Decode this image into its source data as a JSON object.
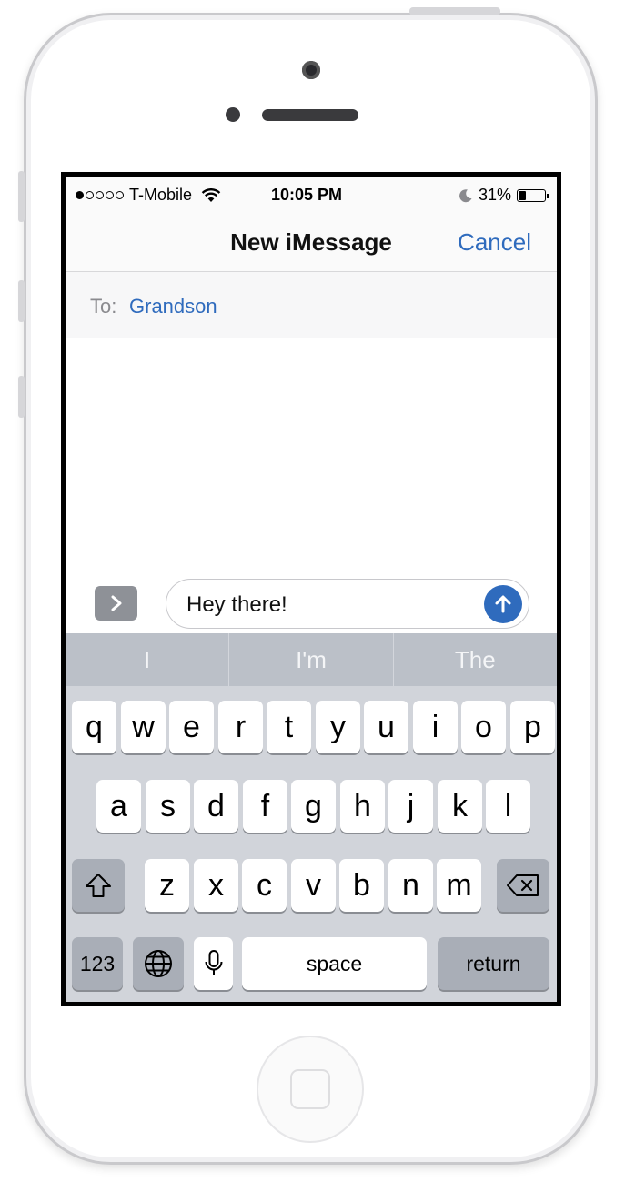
{
  "status_bar": {
    "signal_dots_filled": 1,
    "signal_dots_total": 5,
    "carrier": "T-Mobile",
    "time": "10:05 PM",
    "battery": "31%",
    "battery_level": 0.31
  },
  "nav": {
    "title": "New iMessage",
    "cancel_label": "Cancel"
  },
  "recipient": {
    "label": "To:",
    "name": "Grandson"
  },
  "compose": {
    "message_text": "Hey there!"
  },
  "suggestions": [
    "I",
    "I'm",
    "The"
  ],
  "keyboard": {
    "row1": [
      "q",
      "w",
      "e",
      "r",
      "t",
      "y",
      "u",
      "i",
      "o",
      "p"
    ],
    "row2": [
      "a",
      "s",
      "d",
      "f",
      "g",
      "h",
      "j",
      "k",
      "l"
    ],
    "row3": [
      "z",
      "x",
      "c",
      "v",
      "b",
      "n",
      "m"
    ],
    "numbers_label": "123",
    "space_label": "space",
    "return_label": "return"
  },
  "colors": {
    "accent": "#2f6bbd",
    "keyboard_bg": "#d1d4da",
    "suggestion_bg": "#bbc0c8",
    "dark_key": "#a9aeb7"
  }
}
